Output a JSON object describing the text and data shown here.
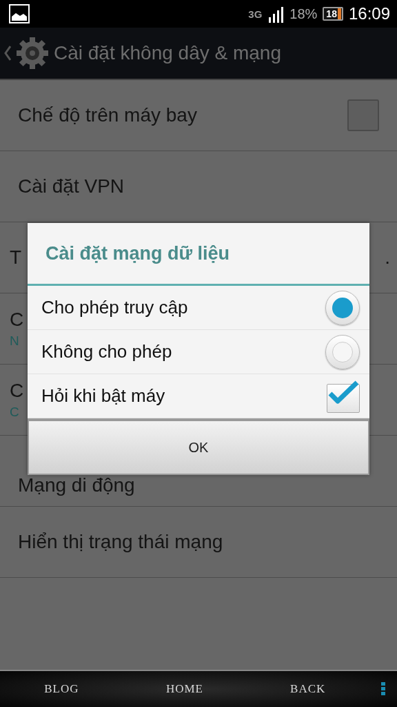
{
  "status_bar": {
    "network": "3G",
    "battery_percent": "18%",
    "battery_icon_text": "18",
    "time": "16:09"
  },
  "action_bar": {
    "title": "Cài đặt không dây & mạng"
  },
  "settings": [
    {
      "title": "Chế độ trên máy bay",
      "kind": "checkbox",
      "checked": false
    },
    {
      "title": "Cài đặt VPN",
      "kind": "plain"
    },
    {
      "title": "T",
      "trailing": ".",
      "kind": "plain"
    },
    {
      "title": "C",
      "summary": "N",
      "kind": "plain"
    },
    {
      "title": "C",
      "summary": "C",
      "kind": "plain"
    },
    {
      "title": "Mạng di động",
      "kind": "plain"
    },
    {
      "title": "Hiển thị trạng thái mạng",
      "kind": "plain"
    }
  ],
  "dialog": {
    "title": "Cài đặt mạng dữ liệu",
    "options": [
      {
        "label": "Cho phép truy cập",
        "kind": "radio",
        "selected": true
      },
      {
        "label": "Không cho phép",
        "kind": "radio",
        "selected": false
      },
      {
        "label": "Hỏi khi bật máy",
        "kind": "checkbox",
        "checked": true
      }
    ],
    "button": "OK"
  },
  "nav_bar": {
    "buttons": [
      "BLOG",
      "HOME",
      "BACK"
    ]
  }
}
